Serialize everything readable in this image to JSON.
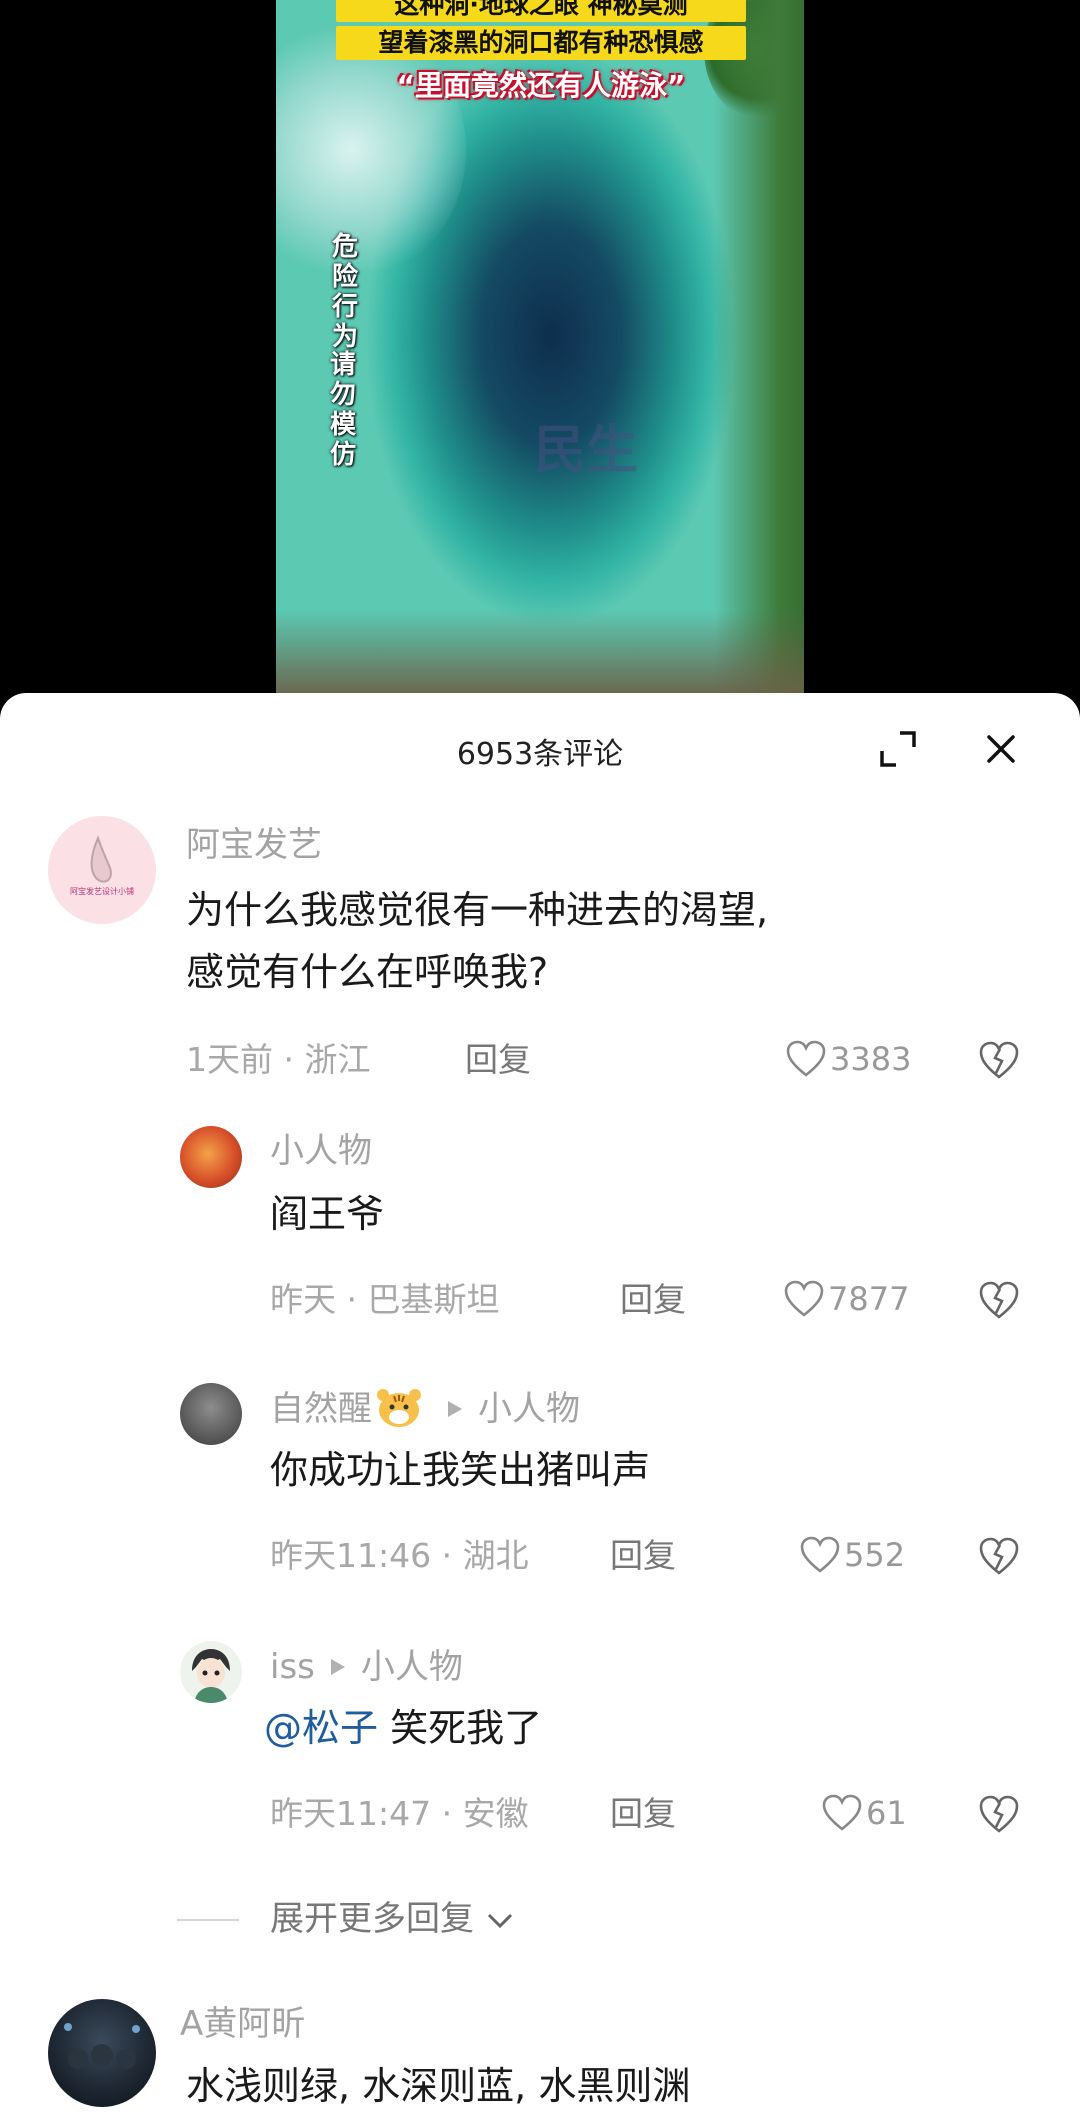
{
  "video": {
    "caption_line1": "这种洞·地球之眼 神秘莫测",
    "caption_line2": "望着漆黑的洞口都有种恐惧感",
    "caption_line3": "“里面竟然还有人游泳”",
    "warning_a": "危险行为",
    "warning_b": "请勿模仿",
    "watermark": "民生"
  },
  "header": {
    "title": "6953条评论",
    "expand_icon": "expand-icon",
    "close_icon": "close-icon"
  },
  "comments": [
    {
      "user": "阿宝发艺",
      "avatar_text": "阿宝发艺设计小铺",
      "line1": "为什么我感觉很有一种进去的渴望,",
      "line2": "感觉有什么在呼唤我?",
      "time": "1天前 · 浙江",
      "reply_label": "回复",
      "likes": "3383"
    },
    {
      "user": "小人物",
      "text": "阎王爷",
      "time": "昨天 · 巴基斯坦",
      "reply_label": "回复",
      "likes": "7877"
    },
    {
      "user": "自然醒",
      "reply_to": "小人物",
      "text": "你成功让我笑出猪叫声",
      "time": "昨天11:46 · 湖北",
      "reply_label": "回复",
      "likes": "552"
    },
    {
      "user": "iss",
      "reply_to": "小人物",
      "mention": "@松子",
      "text": "笑死我了",
      "time": "昨天11:47 · 安徽",
      "reply_label": "回复",
      "likes": "61"
    },
    {
      "user": "A黄阿昕",
      "text": "水浅则绿, 水深则蓝, 水黑则渊"
    }
  ],
  "expand_more": "展开更多回复",
  "colors": {
    "mention": "#1f5d9c",
    "video_caption_bg": "#f5d91a"
  }
}
